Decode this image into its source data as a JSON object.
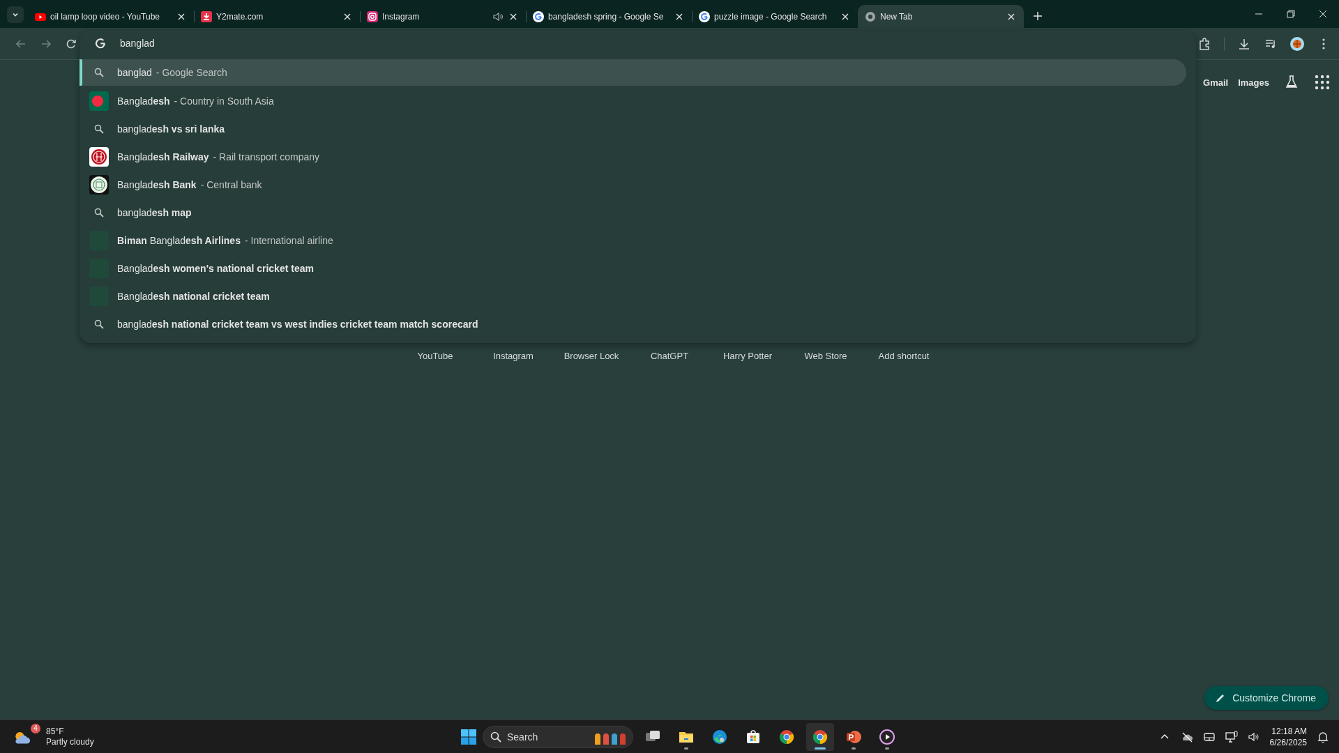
{
  "tabs": [
    {
      "title": "oil lamp loop video - YouTube",
      "kind": "youtube",
      "audible": false,
      "selected": false
    },
    {
      "title": "Y2mate.com",
      "kind": "download",
      "audible": false,
      "selected": false
    },
    {
      "title": "Instagram",
      "kind": "instagram",
      "audible": true,
      "selected": false
    },
    {
      "title": "bangladesh spring - Google Se",
      "kind": "google",
      "audible": false,
      "selected": false
    },
    {
      "title": "puzzle image - Google Search",
      "kind": "google",
      "audible": false,
      "selected": false
    },
    {
      "title": "New Tab",
      "kind": "chrome",
      "audible": false,
      "selected": true
    }
  ],
  "omnibox": {
    "value": "banglad"
  },
  "suggestions": [
    {
      "kind": "search",
      "text": "banglad",
      "description": "- Google Search",
      "selected": true
    },
    {
      "kind": "flag",
      "text": "Banglad**esh**",
      "description": "- Country in South Asia",
      "selected": false
    },
    {
      "kind": "search",
      "text": "banglad**esh vs sri lanka**",
      "selected": false
    },
    {
      "kind": "railway",
      "text": "Banglad**esh Railway**",
      "description": "- Rail transport company",
      "selected": false
    },
    {
      "kind": "bank",
      "text": "Banglad**esh Bank**",
      "description": "- Central bank",
      "selected": false
    },
    {
      "kind": "search",
      "text": "banglad**esh map**",
      "selected": false
    },
    {
      "kind": "thumbnail",
      "text": "**Biman** Banglad**esh Airlines**",
      "description": "- International airline",
      "selected": false
    },
    {
      "kind": "thumbnail",
      "text": "Banglad**esh women's national cricket team**",
      "selected": false
    },
    {
      "kind": "thumbnail",
      "text": "Banglad**esh national cricket team**",
      "selected": false
    },
    {
      "kind": "search",
      "text": "banglad**esh national cricket team vs west indies cricket team match scorecard**",
      "selected": false
    }
  ],
  "header_links": [
    "Gmail",
    "Images"
  ],
  "shortcuts": [
    "YouTube",
    "Instagram",
    "Browser Lock",
    "ChatGPT",
    "Harry Potter",
    "Web Store",
    "Add shortcut"
  ],
  "customize_button": "Customize Chrome",
  "taskbar": {
    "weather": {
      "badge": "4",
      "temperature": "85°F",
      "condition": "Partly cloudy"
    },
    "search_placeholder": "Search",
    "apps": [
      {
        "kind": "task-view",
        "running": false,
        "selected": false
      },
      {
        "kind": "folder",
        "running": true,
        "selected": false
      },
      {
        "kind": "edge",
        "running": false,
        "selected": false
      },
      {
        "kind": "store",
        "running": false,
        "selected": false
      },
      {
        "kind": "chrome",
        "running": false,
        "selected": false
      },
      {
        "kind": "chrome",
        "running": true,
        "selected": true
      },
      {
        "kind": "powerpoint",
        "running": true,
        "selected": false
      },
      {
        "kind": "player",
        "running": true,
        "selected": false
      }
    ],
    "time": "12:18 AM",
    "date": "6/26/2025"
  }
}
